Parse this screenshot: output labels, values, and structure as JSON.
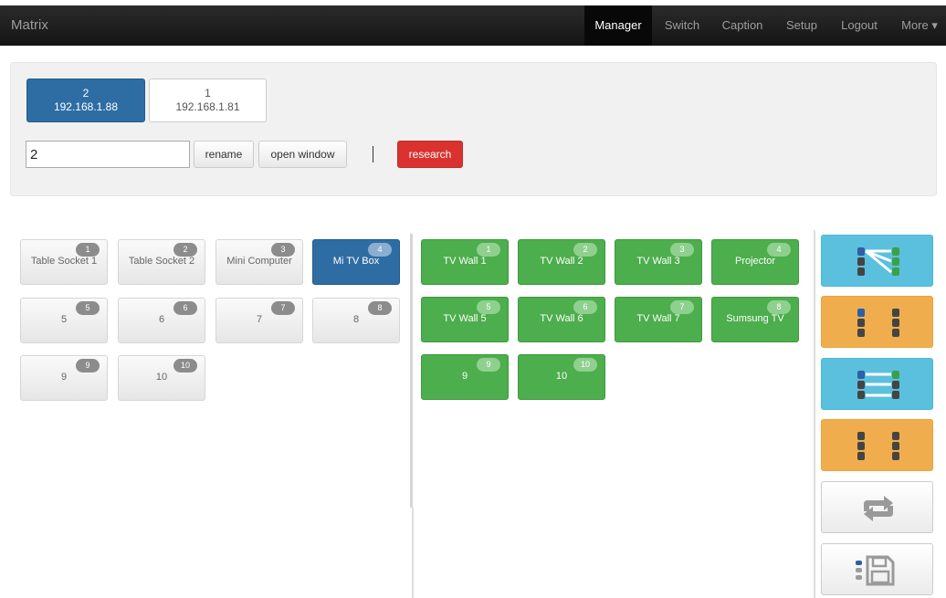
{
  "app": {
    "title": "Matrix"
  },
  "nav": {
    "items": [
      {
        "label": "Manager",
        "active": true
      },
      {
        "label": "Switch"
      },
      {
        "label": "Caption"
      },
      {
        "label": "Setup"
      },
      {
        "label": "Logout"
      },
      {
        "label": "More ▾"
      }
    ]
  },
  "devices": [
    {
      "id": "2",
      "ip": "192.168.1.88",
      "selected": true
    },
    {
      "id": "1",
      "ip": "192.168.1.81",
      "selected": false
    }
  ],
  "name_input": {
    "value": "2"
  },
  "buttons": {
    "rename": "rename",
    "open_window": "open window",
    "separator": "|",
    "research": "research"
  },
  "inputs": [
    {
      "num": "1",
      "label": "Table Socket 1"
    },
    {
      "num": "2",
      "label": "Table Socket 2"
    },
    {
      "num": "3",
      "label": "Mini Computer"
    },
    {
      "num": "4",
      "label": "Mi TV Box",
      "selected": true
    },
    {
      "num": "5",
      "label": "5"
    },
    {
      "num": "6",
      "label": "6"
    },
    {
      "num": "7",
      "label": "7"
    },
    {
      "num": "8",
      "label": "8"
    },
    {
      "num": "9",
      "label": "9"
    },
    {
      "num": "10",
      "label": "10"
    }
  ],
  "outputs": [
    {
      "num": "1",
      "label": "TV Wall 1"
    },
    {
      "num": "2",
      "label": "TV Wall 2"
    },
    {
      "num": "3",
      "label": "TV Wall 3"
    },
    {
      "num": "4",
      "label": "Projector"
    },
    {
      "num": "5",
      "label": "TV Wall 5"
    },
    {
      "num": "6",
      "label": "TV Wall 6"
    },
    {
      "num": "7",
      "label": "TV Wall 7"
    },
    {
      "num": "8",
      "label": "Sumsung TV"
    },
    {
      "num": "9",
      "label": "9"
    },
    {
      "num": "10",
      "label": "10"
    }
  ],
  "actions": [
    {
      "name": "connect-one-to-many",
      "color": "#5bc0de",
      "icon": "one-to-many-icon"
    },
    {
      "name": "disconnect-all",
      "color": "#f0ad4e",
      "icon": "disconnect-icon"
    },
    {
      "name": "connect-one-to-one",
      "color": "#5bc0de",
      "icon": "one-to-one-icon"
    },
    {
      "name": "clear-all",
      "color": "#f0ad4e",
      "icon": "disconnect-icon"
    },
    {
      "name": "refresh",
      "color": "#cccccc",
      "icon": "refresh-icon"
    },
    {
      "name": "save-scene",
      "color": "#cccccc",
      "icon": "save-icon"
    }
  ]
}
